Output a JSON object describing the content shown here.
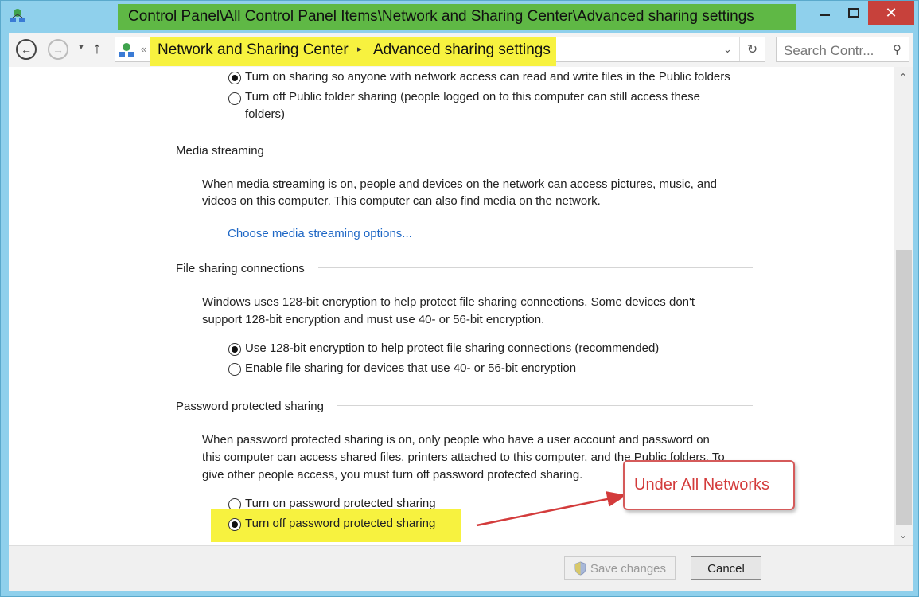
{
  "window": {
    "title": "Control Panel\\All Control Panel Items\\Network and Sharing Center\\Advanced sharing settings",
    "close_glyph": "✕"
  },
  "nav": {
    "breadcrumb_overflow": "«",
    "crumbs": [
      "Network and Sharing Center",
      "Advanced sharing settings"
    ],
    "crumb_separator": "▸",
    "search_placeholder": "Search Contr..."
  },
  "public_folder": {
    "options": [
      {
        "label": "Turn on sharing so anyone with network access can read and write files in the Public folders",
        "checked": true
      },
      {
        "label_line1": "Turn off Public folder sharing (people logged on to this computer can still access these",
        "label_line2": "folders)",
        "checked": false
      }
    ]
  },
  "media_streaming": {
    "heading": "Media streaming",
    "desc_line1": "When media streaming is on, people and devices on the network can access pictures, music, and",
    "desc_line2": "videos on this computer. This computer can also find media on the network.",
    "link": "Choose media streaming options..."
  },
  "file_sharing": {
    "heading": "File sharing connections",
    "desc_line1": "Windows uses 128-bit encryption to help protect file sharing connections. Some devices don't",
    "desc_line2": "support 128-bit encryption and must use 40- or 56-bit encryption.",
    "options": [
      {
        "label": "Use 128-bit encryption to help protect file sharing connections (recommended)",
        "checked": true
      },
      {
        "label": "Enable file sharing for devices that use 40- or 56-bit encryption",
        "checked": false
      }
    ]
  },
  "password_sharing": {
    "heading": "Password protected sharing",
    "desc_line1": "When password protected sharing is on, only people who have a user account and password on",
    "desc_line2": "this computer can access shared files, printers attached to this computer, and the Public folders. To",
    "desc_line3": "give other people access, you must turn off password protected sharing.",
    "options": [
      {
        "label": "Turn on password protected sharing",
        "checked": false
      },
      {
        "label": "Turn off password protected sharing",
        "checked": true
      }
    ]
  },
  "annotation": {
    "callout_text": "Under All Networks",
    "color": "#d33b3b"
  },
  "footer": {
    "save_label": "Save changes",
    "cancel_label": "Cancel"
  },
  "colors": {
    "title_highlight": "#5fb845",
    "yellow_highlight": "#f7f23f",
    "link": "#1e67c5",
    "close_button": "#c7413b"
  }
}
